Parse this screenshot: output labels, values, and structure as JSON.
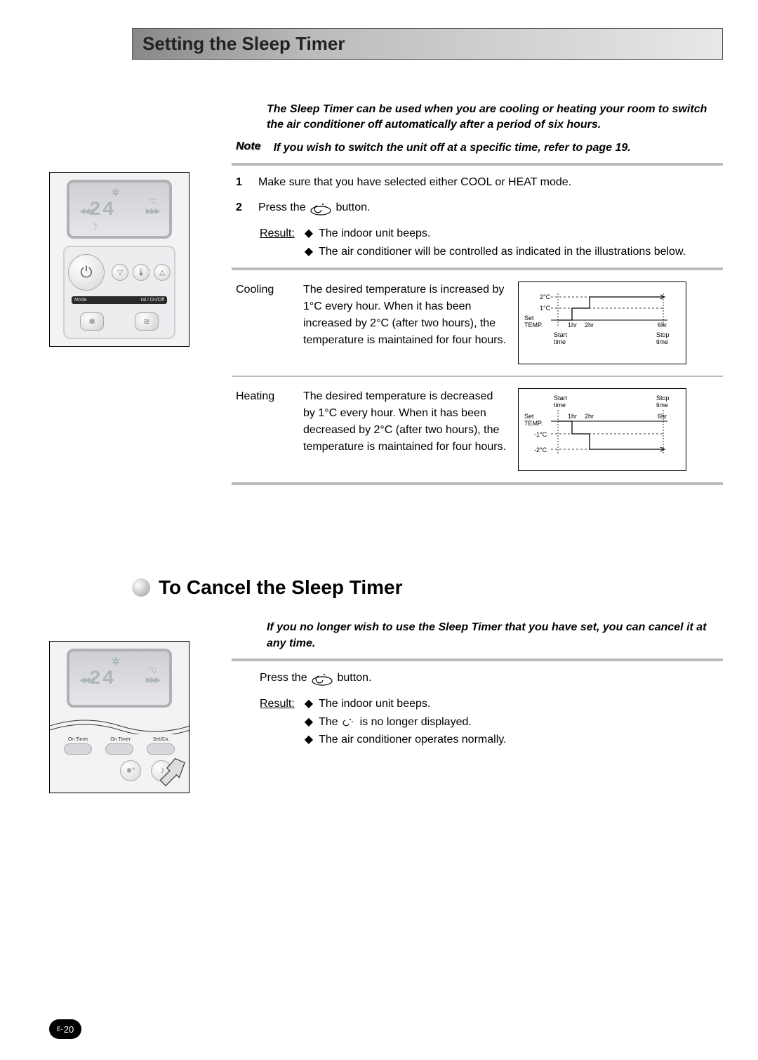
{
  "section1": {
    "title": "Setting the Sleep Timer",
    "intro": "The Sleep Timer can be used when you are cooling or heating your room to switch the air conditioner off automatically after a period of six hours.",
    "note_label": "Note",
    "note_text": "If you wish to switch the unit off at a specific time, refer to page 19.",
    "step1": {
      "num": "1",
      "text": "Make sure that you have selected either COOL or HEAT mode."
    },
    "step2": {
      "num": "2",
      "pre": "Press the",
      "post": "button."
    },
    "result_label": "Result:",
    "result_items": [
      "The indoor unit beeps.",
      "The air conditioner will be controlled as indicated in the illustrations below."
    ],
    "cooling": {
      "label": "Cooling",
      "desc": "The desired temperature is increased by 1°C every hour. When it has been increased by 2°C (after two hours), the temperature is maintained for four hours."
    },
    "heating": {
      "label": "Heating",
      "desc": "The desired temperature is decreased by 1°C every hour. When it has been decreased by 2°C (after two hours), the temperature is maintained for four hours."
    }
  },
  "section2": {
    "title": "To Cancel the Sleep Timer",
    "intro": "If you no longer wish to use the Sleep Timer that you have set, you can cancel it at any time.",
    "press_pre": "Press the",
    "press_post": "button.",
    "result_label": "Result:",
    "result_items": {
      "r1": "The indoor unit beeps.",
      "r2_pre": "The",
      "r2_post": "is no longer displayed.",
      "r3": "The air conditioner operates normally."
    }
  },
  "remote": {
    "temp_display": "24",
    "unit": "°C",
    "mode_label": "Mode",
    "digital_label": "tal",
    "onoff_label": "On/Off",
    "timer_labels": [
      "On Timer",
      "On Timer",
      "Set/Ca.."
    ]
  },
  "page_number": {
    "prefix": "E-",
    "num": "20"
  },
  "chart_data": [
    {
      "type": "line",
      "name": "cooling",
      "xlabel_set": "Set TEMP.",
      "x_ticks": [
        "1hr",
        "2hr",
        "6hr"
      ],
      "y_ticks": [
        "1°C",
        "2°C"
      ],
      "start_label": "Start time",
      "stop_label": "Stop time",
      "series": [
        {
          "name": "temp_delta",
          "x": [
            0,
            1,
            1,
            2,
            2,
            6
          ],
          "y": [
            0,
            0,
            1,
            1,
            2,
            2
          ]
        }
      ],
      "ylim": [
        0,
        2
      ]
    },
    {
      "type": "line",
      "name": "heating",
      "xlabel_set": "Set TEMP.",
      "x_ticks": [
        "1hr",
        "2hr",
        "6hr"
      ],
      "y_ticks": [
        "-1°C",
        "-2°C"
      ],
      "start_label": "Start time",
      "stop_label": "Stop time",
      "series": [
        {
          "name": "temp_delta",
          "x": [
            0,
            1,
            1,
            2,
            2,
            6
          ],
          "y": [
            0,
            0,
            -1,
            -1,
            -2,
            -2
          ]
        }
      ],
      "ylim": [
        -2,
        0
      ]
    }
  ]
}
